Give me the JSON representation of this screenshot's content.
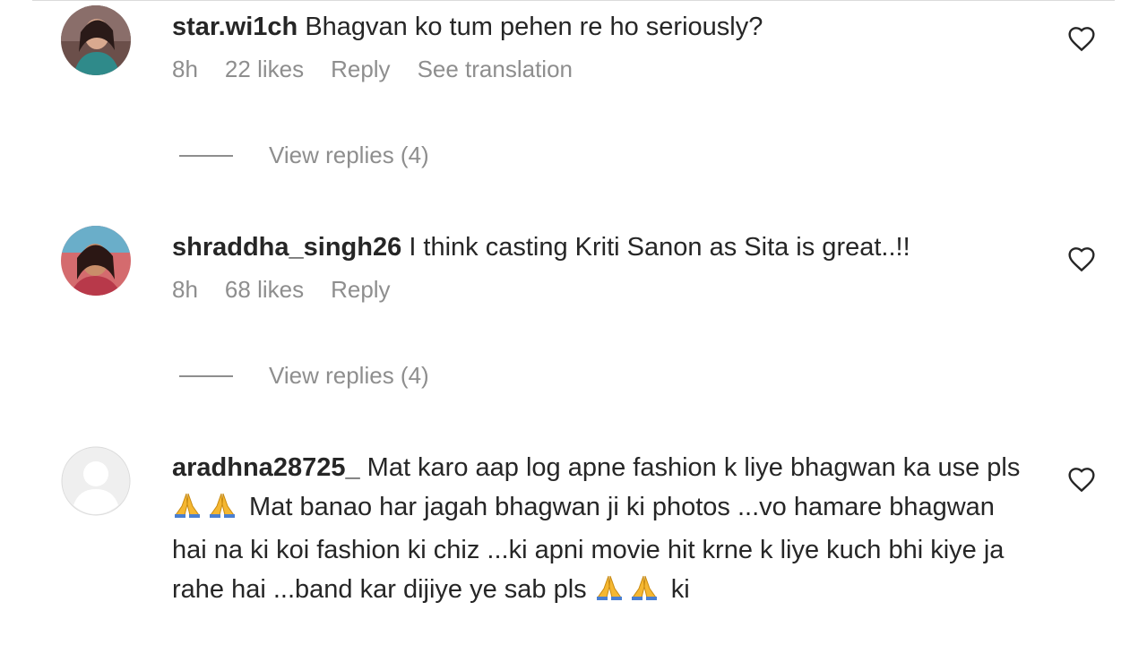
{
  "comments": [
    {
      "username": "star.wi1ch",
      "text": "Bhagvan ko tum pehen re ho seriously?",
      "time": "8h",
      "likes": "22 likes",
      "reply": "Reply",
      "translate": "See translation",
      "view_replies": "View replies (4)"
    },
    {
      "username": "shraddha_singh26",
      "text": "I think casting Kriti Sanon as Sita is great..!!",
      "time": "8h",
      "likes": "68 likes",
      "reply": "Reply",
      "view_replies": "View replies (4)"
    },
    {
      "username": "aradhna28725_",
      "text_parts": [
        "Mat karo aap log apne fashion k liye bhagwan ka use pls ",
        " Mat banao har jagah bhagwan ji ki photos ...vo hamare bhagwan hai na ki koi fashion ki chiz ...ki apni movie hit krne k liye kuch bhi kiye ja rahe hai ...band kar dijiye ye sab pls ",
        " ki"
      ],
      "emoji": "folded-hands-icon"
    }
  ],
  "colors": {
    "text": "#262626",
    "secondary": "#8e8e8e",
    "emoji": "#f5b731"
  }
}
